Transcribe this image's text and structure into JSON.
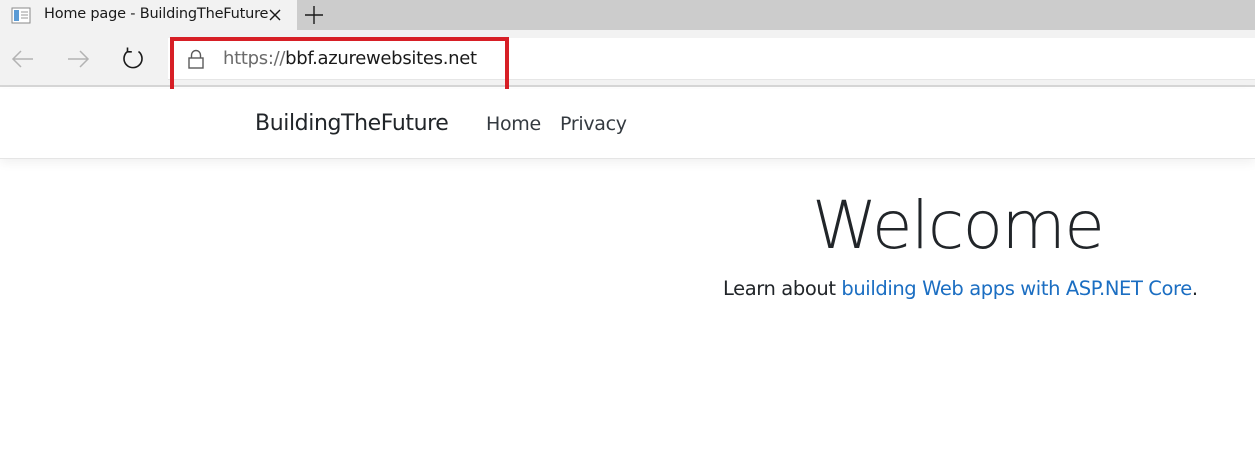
{
  "browser": {
    "tab": {
      "title": "Home page - BuildingTheFuture",
      "favicon": "page-icon"
    },
    "address": {
      "scheme": "https://",
      "host": "bbf.azurewebsites.net"
    },
    "icons": {
      "back": "arrow-left-icon",
      "forward": "arrow-right-icon",
      "refresh": "refresh-icon",
      "lock": "lock-icon",
      "close": "close-icon",
      "new_tab": "plus-icon"
    },
    "highlight_color": "#d71f26"
  },
  "site": {
    "brand": "BuildingTheFuture",
    "nav": {
      "home": "Home",
      "privacy": "Privacy"
    }
  },
  "main": {
    "heading": "Welcome",
    "learn_prefix": "Learn about ",
    "learn_link": "building Web apps with ASP.NET Core",
    "learn_suffix": ".",
    "link_color": "#1b6ec2"
  }
}
